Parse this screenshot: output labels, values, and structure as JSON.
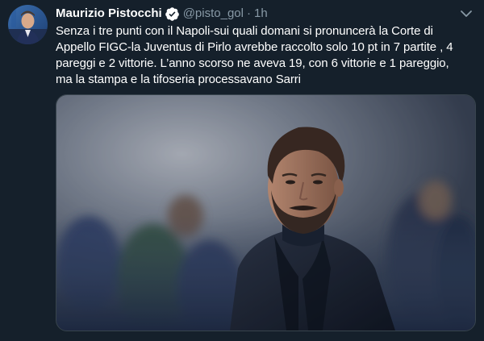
{
  "tweet": {
    "author_name": "Maurizio Pistocchi",
    "handle": "@pisto_gol",
    "separator": "·",
    "timestamp": "1h",
    "text": "Senza i tre punti con il Napoli-sui quali domani si pronuncerà la Corte di\nAppello FIGC-la Juventus di Pirlo avrebbe raccolto solo 10 pt in 7 partite , 4\npareggi e 2 vittorie. L’anno scorso ne aveva 19, con 6 vittorie e 1 pareggio,\nma la stampa e la tifoseria processavano Sarri",
    "verified": true
  },
  "icons": {
    "avatar": "profile-photo",
    "verified": "verified-badge-icon",
    "menu": "chevron-down-icon",
    "media": "photo-man-in-dark-jacket"
  },
  "colors": {
    "background": "#15202b",
    "secondary_text": "#8899a6",
    "primary_text": "#ffffff",
    "verified_badge": "#ffffff",
    "border": "#38444d"
  }
}
